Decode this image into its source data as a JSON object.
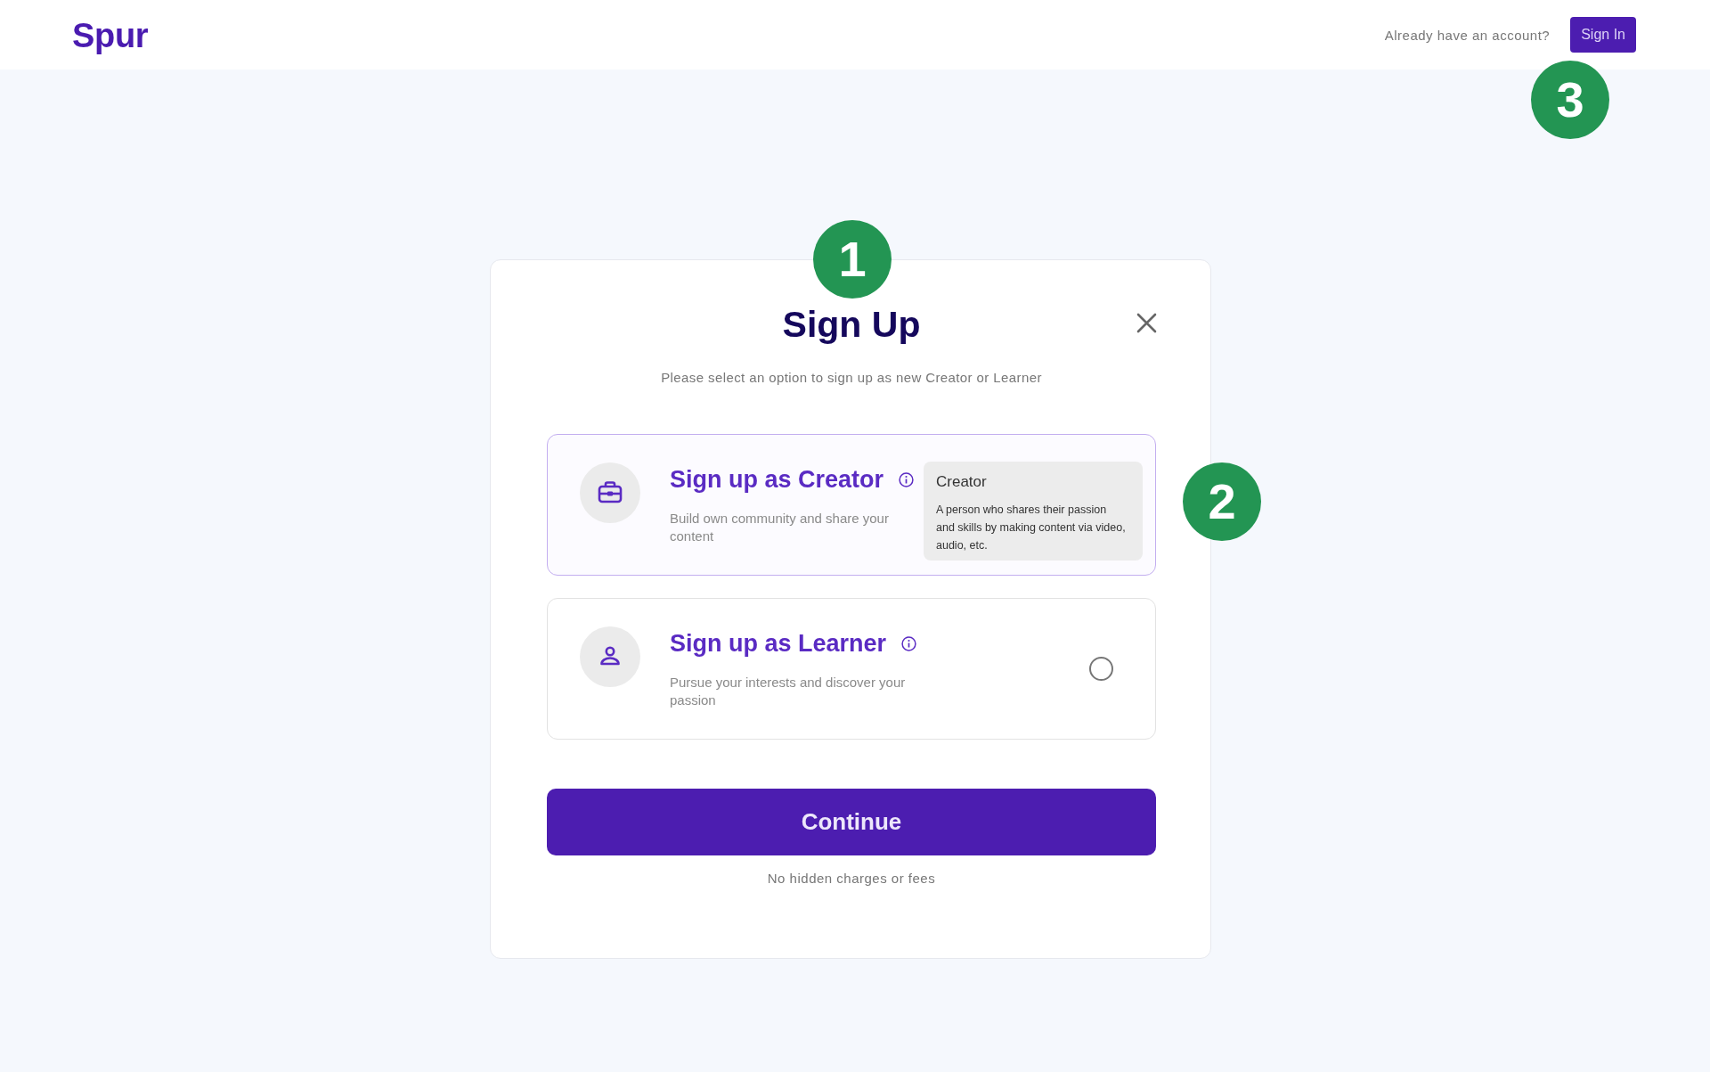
{
  "header": {
    "logo": "Spur",
    "account_prompt": "Already have an account?",
    "sign_in_button": "Sign In",
    "callout": "3"
  },
  "modal": {
    "callout": "1",
    "title": "Sign Up",
    "subtitle": "Please select an option to sign up as new Creator or Learner",
    "options": [
      {
        "kind": "creator",
        "title": "Sign up as Creator",
        "description": "Build own community and share your content",
        "selected": true,
        "callout": "2",
        "tooltip": {
          "title": "Creator",
          "text": "A person who shares their passion and skills by making content via video, audio, etc."
        }
      },
      {
        "kind": "learner",
        "title": "Sign up as Learner",
        "description": "Pursue your interests and discover your passion",
        "selected": false
      }
    ],
    "continue_button": "Continue",
    "footnote": "No hidden charges or fees"
  }
}
